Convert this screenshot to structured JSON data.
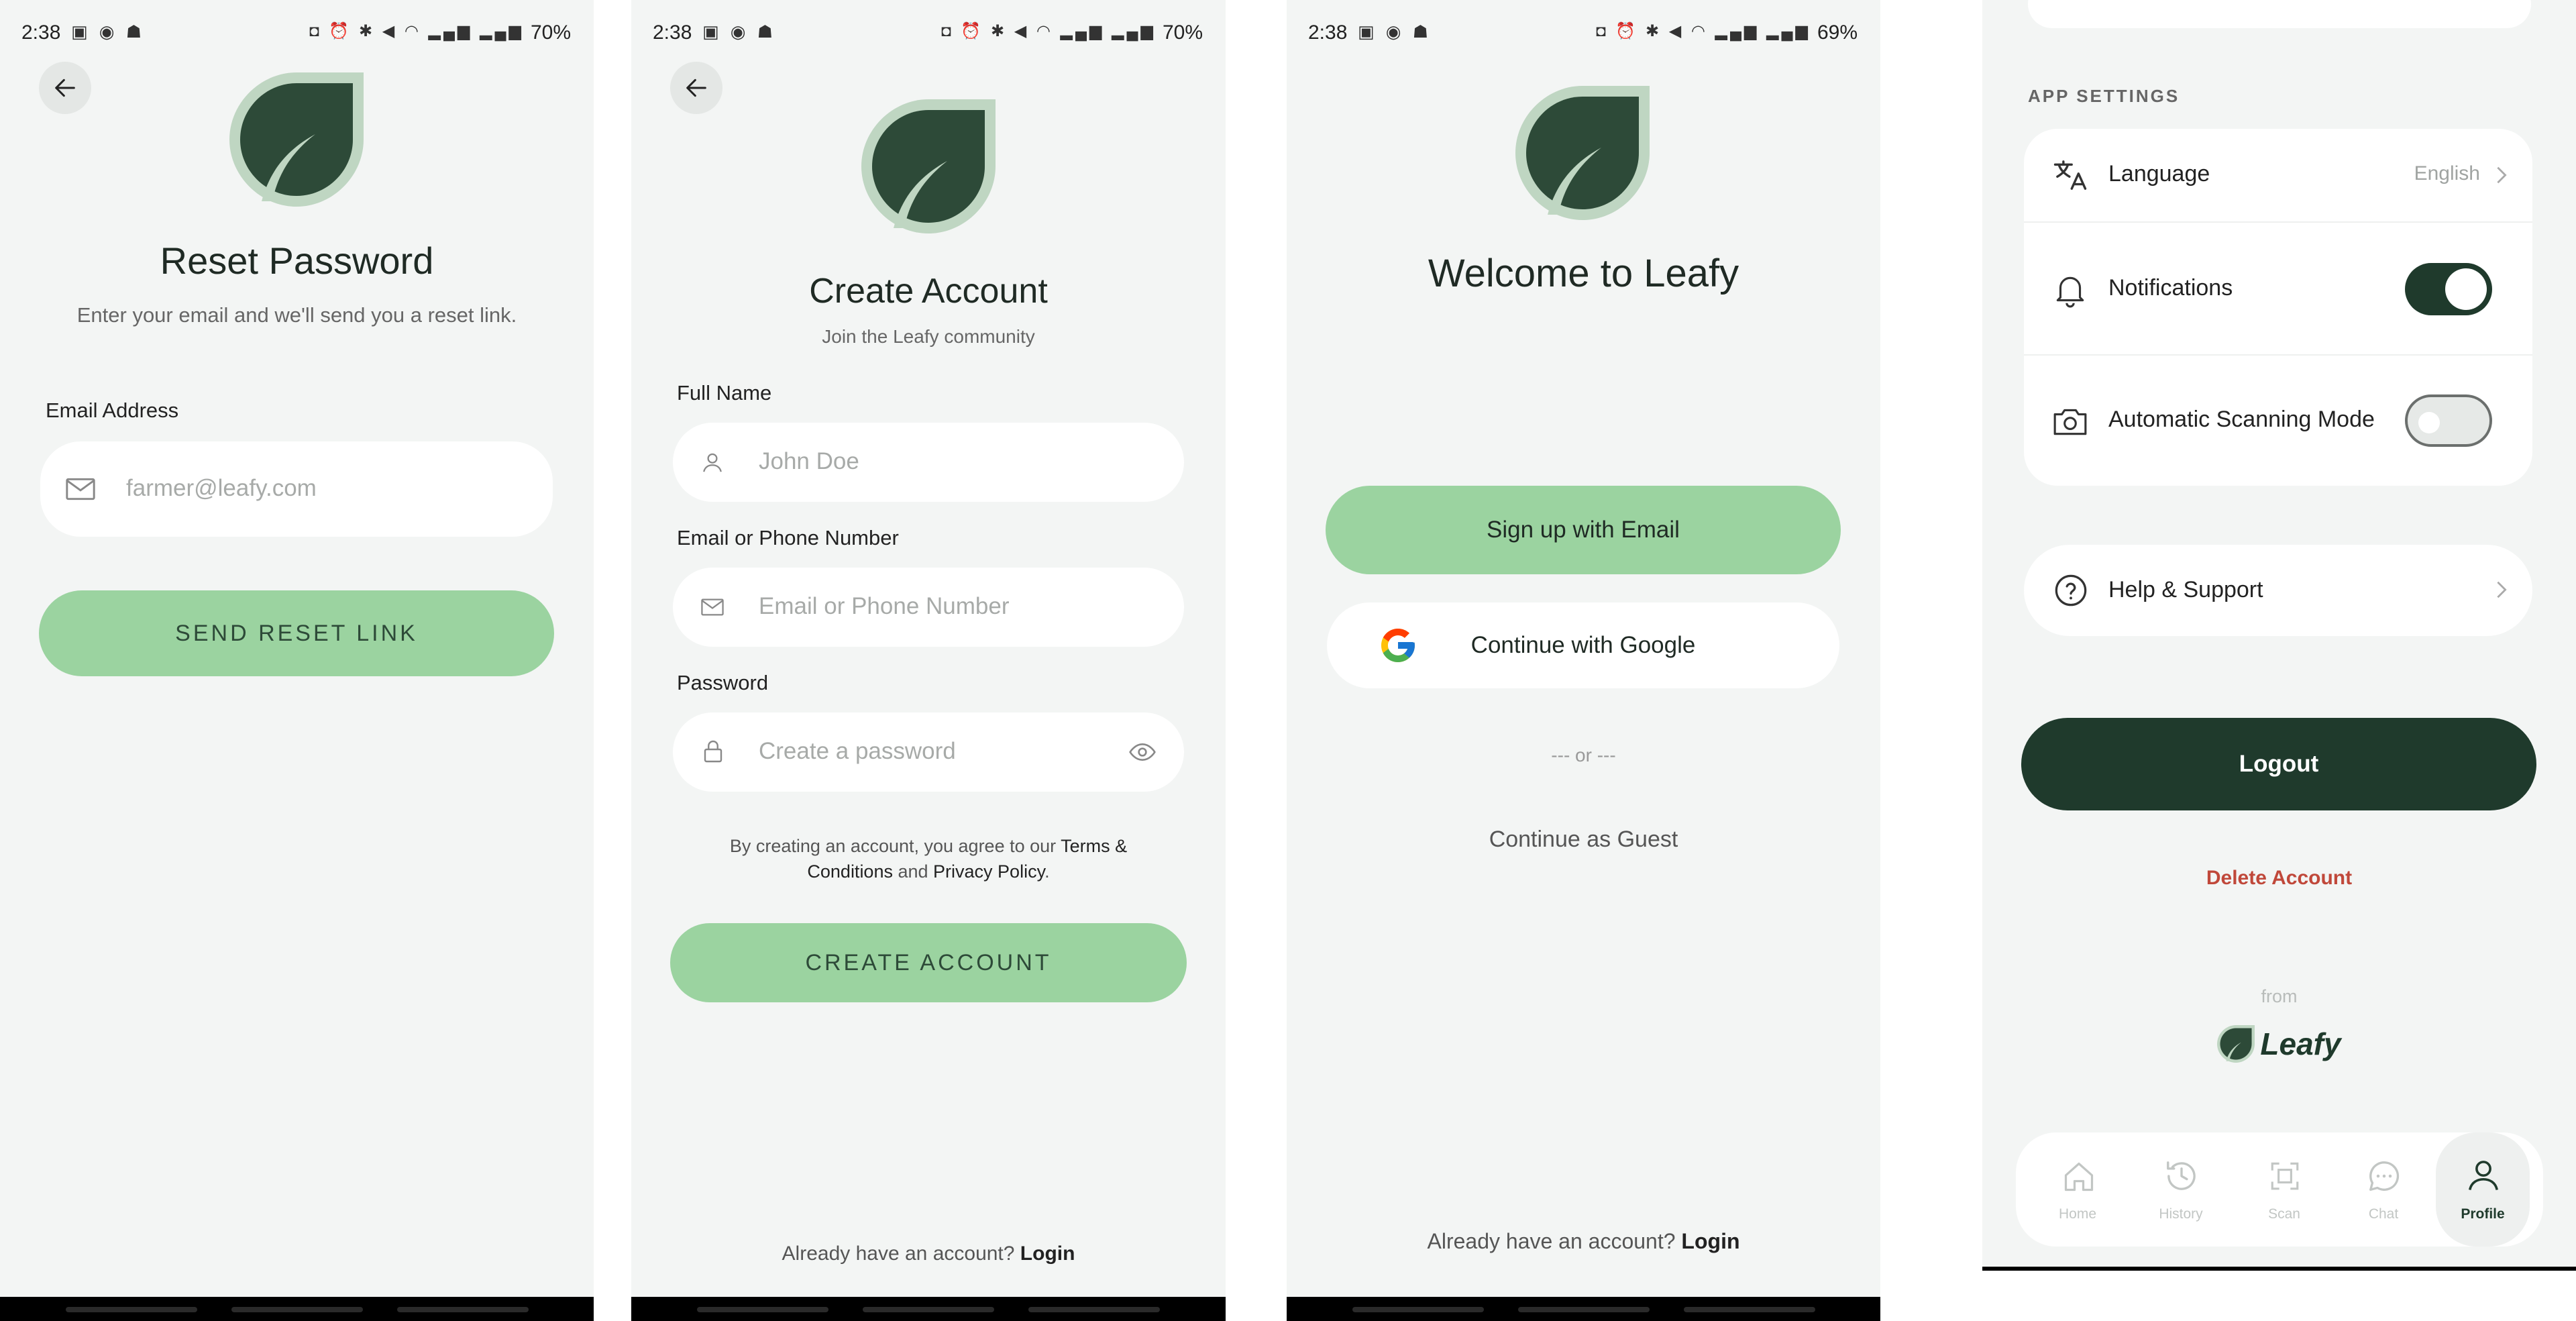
{
  "colors": {
    "bg": "#f3f5f4",
    "accent": "#9bd3a0",
    "dark": "#1f3a2c",
    "danger": "#c0483a"
  },
  "status_bars": [
    {
      "time": "2:38",
      "battery": "70%"
    },
    {
      "time": "2:38",
      "battery": "70%"
    },
    {
      "time": "2:38",
      "battery": "69%"
    }
  ],
  "reset": {
    "title": "Reset Password",
    "subtitle": "Enter your email and we'll send you a reset link.",
    "email_label": "Email Address",
    "email_placeholder": "farmer@leafy.com",
    "send_button": "SEND RESET LINK"
  },
  "create": {
    "title": "Create Account",
    "subtitle": "Join the Leafy community",
    "name_label": "Full Name",
    "name_placeholder": "John Doe",
    "contact_label": "Email or Phone Number",
    "contact_placeholder": "Email or Phone Number",
    "password_label": "Password",
    "password_placeholder": "Create a password",
    "terms_prefix": "By creating an account, you agree to our ",
    "terms_link": "Terms & Conditions",
    "terms_and": " and ",
    "privacy_link": "Privacy Policy",
    "terms_suffix": ".",
    "create_button": "CREATE ACCOUNT",
    "have_account": "Already have an account?",
    "login_link": "Login"
  },
  "welcome": {
    "title": "Welcome to Leafy",
    "signup_email": "Sign up with Email",
    "google": "Continue with Google",
    "or": "--- or ---",
    "guest": "Continue as Guest",
    "have_account": "Already have an account?",
    "login_link": "Login"
  },
  "settings": {
    "section_title": "APP SETTINGS",
    "language_label": "Language",
    "language_value": "English",
    "notifications_label": "Notifications",
    "notifications_on": true,
    "auto_scan_label": "Automatic Scanning Mode",
    "auto_scan_on": false,
    "help_label": "Help & Support",
    "logout": "Logout",
    "delete": "Delete Account",
    "from": "from",
    "brand": "Leafy",
    "tabs": [
      {
        "label": "Home",
        "icon": "home-icon",
        "active": false
      },
      {
        "label": "History",
        "icon": "history-icon",
        "active": false
      },
      {
        "label": "Scan",
        "icon": "scan-icon",
        "active": false
      },
      {
        "label": "Chat",
        "icon": "chat-icon",
        "active": false
      },
      {
        "label": "Profile",
        "icon": "profile-icon",
        "active": true
      }
    ]
  }
}
